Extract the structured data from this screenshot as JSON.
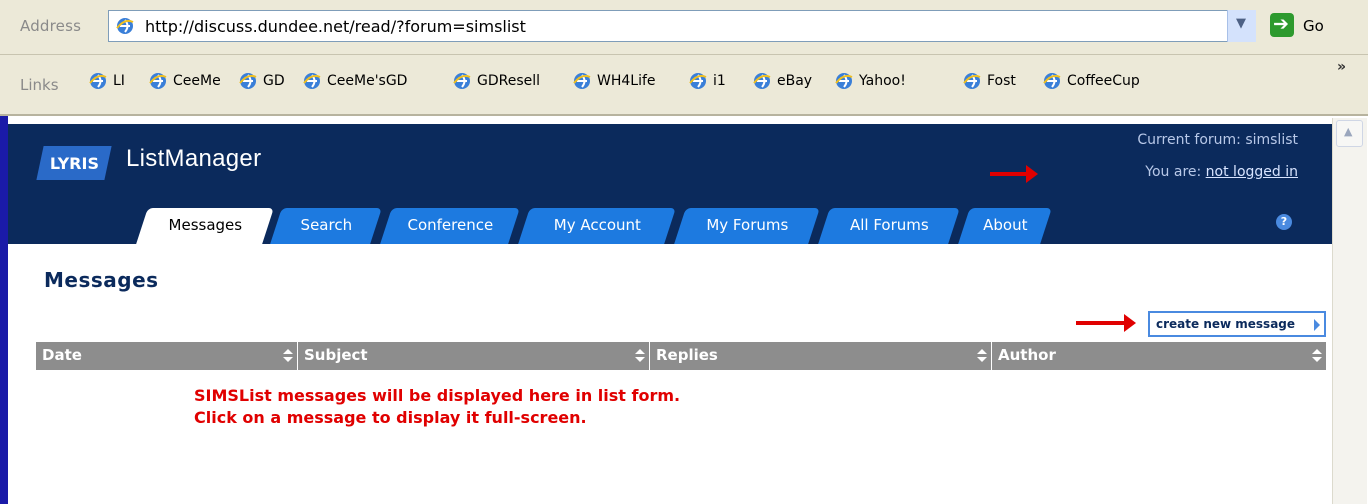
{
  "browser": {
    "address_label": "Address",
    "url": "http://discuss.dundee.net/read/?forum=simslist",
    "go_label": "Go",
    "links_label": "Links",
    "links": [
      "LI",
      "CeeMe",
      "GD",
      "CeeMe'sGD",
      "GDResell",
      "WH4Life",
      "i1",
      "eBay",
      "Yahoo!",
      "Fost",
      "CoffeeCup"
    ],
    "links_more": "»"
  },
  "header": {
    "logo_text": "LYRIS",
    "product_name": "ListManager",
    "current_forum_text": "Current forum: simslist",
    "you_are_label": "You are: ",
    "login_status": "not logged in",
    "help_icon": "?"
  },
  "tabs": [
    {
      "label": "Messages",
      "active": true
    },
    {
      "label": "Search",
      "active": false
    },
    {
      "label": "Conference",
      "active": false
    },
    {
      "label": "My Account",
      "active": false
    },
    {
      "label": "My Forums",
      "active": false
    },
    {
      "label": "All Forums",
      "active": false
    },
    {
      "label": "About",
      "active": false
    }
  ],
  "page": {
    "title": "Messages",
    "create_button": "create new message",
    "columns": [
      "Date",
      "Subject",
      "Replies",
      "Author"
    ],
    "note_line1": "SIMSList messages will be displayed here in list form.",
    "note_line2": "Click on a message to display it full-screen."
  },
  "colors": {
    "header_bg": "#0b2a5c",
    "tab_bg": "#1d7ae0",
    "annotation_red": "#e00000",
    "table_header_bg": "#8d8d8d"
  }
}
